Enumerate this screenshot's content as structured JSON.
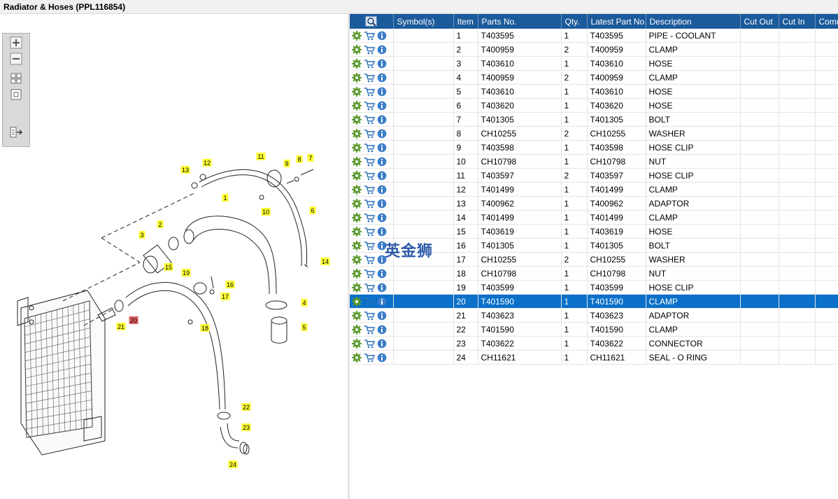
{
  "window": {
    "title": "Radiator & Hoses (PPL116854)"
  },
  "toolbox": {
    "buttons": [
      {
        "name": "zoom-in-icon"
      },
      {
        "name": "zoom-out-icon"
      },
      {
        "name": "fit-all-icon"
      },
      {
        "name": "actual-size-icon"
      },
      {
        "name": "export-icon"
      }
    ]
  },
  "diagram": {
    "callouts": [
      "1",
      "2",
      "3",
      "4",
      "5",
      "6",
      "7",
      "8",
      "9",
      "10",
      "11",
      "12",
      "13",
      "14",
      "15",
      "16",
      "17",
      "18",
      "19",
      "20",
      "21",
      "22",
      "23",
      "24"
    ],
    "highlighted": "20"
  },
  "table": {
    "headers": [
      "",
      "Symbol(s)",
      "Item",
      "Parts No.",
      "Qty.",
      "Latest Part No.",
      "Description",
      "Cut Out",
      "Cut In",
      "Comment"
    ],
    "rows": [
      {
        "item": "1",
        "part": "T403595",
        "qty": "1",
        "latest": "T403595",
        "desc": "PIPE - COOLANT"
      },
      {
        "item": "2",
        "part": "T400959",
        "qty": "2",
        "latest": "T400959",
        "desc": "CLAMP"
      },
      {
        "item": "3",
        "part": "T403610",
        "qty": "1",
        "latest": "T403610",
        "desc": "HOSE"
      },
      {
        "item": "4",
        "part": "T400959",
        "qty": "2",
        "latest": "T400959",
        "desc": "CLAMP"
      },
      {
        "item": "5",
        "part": "T403610",
        "qty": "1",
        "latest": "T403610",
        "desc": "HOSE"
      },
      {
        "item": "6",
        "part": "T403620",
        "qty": "1",
        "latest": "T403620",
        "desc": "HOSE"
      },
      {
        "item": "7",
        "part": "T401305",
        "qty": "1",
        "latest": "T401305",
        "desc": "BOLT"
      },
      {
        "item": "8",
        "part": "CH10255",
        "qty": "2",
        "latest": "CH10255",
        "desc": "WASHER"
      },
      {
        "item": "9",
        "part": "T403598",
        "qty": "1",
        "latest": "T403598",
        "desc": "HOSE CLIP"
      },
      {
        "item": "10",
        "part": "CH10798",
        "qty": "1",
        "latest": "CH10798",
        "desc": "NUT"
      },
      {
        "item": "11",
        "part": "T403597",
        "qty": "2",
        "latest": "T403597",
        "desc": "HOSE CLIP"
      },
      {
        "item": "12",
        "part": "T401499",
        "qty": "1",
        "latest": "T401499",
        "desc": "CLAMP"
      },
      {
        "item": "13",
        "part": "T400962",
        "qty": "1",
        "latest": "T400962",
        "desc": "ADAPTOR"
      },
      {
        "item": "14",
        "part": "T401499",
        "qty": "1",
        "latest": "T401499",
        "desc": "CLAMP"
      },
      {
        "item": "15",
        "part": "T403619",
        "qty": "1",
        "latest": "T403619",
        "desc": "HOSE"
      },
      {
        "item": "16",
        "part": "T401305",
        "qty": "1",
        "latest": "T401305",
        "desc": "BOLT"
      },
      {
        "item": "17",
        "part": "CH10255",
        "qty": "2",
        "latest": "CH10255",
        "desc": "WASHER"
      },
      {
        "item": "18",
        "part": "CH10798",
        "qty": "1",
        "latest": "CH10798",
        "desc": "NUT"
      },
      {
        "item": "19",
        "part": "T403599",
        "qty": "1",
        "latest": "T403599",
        "desc": "HOSE CLIP"
      },
      {
        "item": "20",
        "part": "T401590",
        "qty": "1",
        "latest": "T401590",
        "desc": "CLAMP",
        "selected": true
      },
      {
        "item": "21",
        "part": "T403623",
        "qty": "1",
        "latest": "T403623",
        "desc": "ADAPTOR"
      },
      {
        "item": "22",
        "part": "T401590",
        "qty": "1",
        "latest": "T401590",
        "desc": "CLAMP"
      },
      {
        "item": "23",
        "part": "T403622",
        "qty": "1",
        "latest": "T403622",
        "desc": "CONNECTOR"
      },
      {
        "item": "24",
        "part": "CH11621",
        "qty": "1",
        "latest": "CH11621",
        "desc": "SEAL - O RING"
      }
    ],
    "row_icons": [
      "settings-gear-icon",
      "add-to-cart-icon",
      "info-icon"
    ]
  },
  "watermark": "英金狮",
  "colors": {
    "header_bg": "#1b5a9b",
    "selected_row": "#0a70c9",
    "callout_bg": "#ffff33",
    "callout_highlight": "#e36060"
  }
}
